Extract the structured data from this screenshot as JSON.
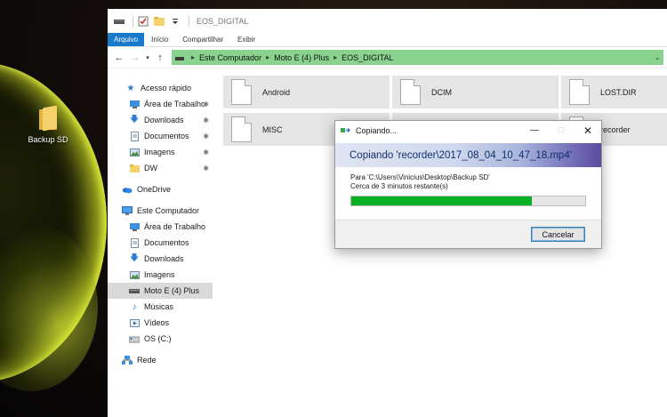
{
  "desktop": {
    "icon_label": "Backup SD"
  },
  "explorer": {
    "title": "EOS_DIGITAL",
    "ribbon_tabs": [
      "Arquivo",
      "Início",
      "Compartilhar",
      "Exibir"
    ],
    "breadcrumb": [
      "Este Computador",
      "Moto E (4) Plus",
      "EOS_DIGITAL"
    ],
    "nav": {
      "quick_access": "Acesso rápido",
      "quick_items": [
        "Área de Trabalho",
        "Downloads",
        "Documentos",
        "Imagens",
        "DW"
      ],
      "onedrive": "OneDrive",
      "this_pc": "Este Computador",
      "pc_items": [
        "Área de Trabalho",
        "Documentos",
        "Downloads",
        "Imagens",
        "Moto E (4) Plus",
        "Músicas",
        "Vídeos",
        "OS (C:)"
      ],
      "network": "Rede"
    },
    "folders": [
      "Android",
      "DCIM",
      "LOST.DIR",
      "MISC",
      "recorder"
    ]
  },
  "dialog": {
    "title": "Copiando...",
    "header": "Copiando 'recorder\\2017_08_04_10_47_18.mp4'",
    "destination": "Para 'C:\\Users\\Vinicius\\Desktop\\Backup SD'",
    "time_remaining": "Cerca de 3 minutos restante(s)",
    "progress": 0.77,
    "cancel_label": "Cancelar"
  },
  "colors": {
    "ribbon_file_tab": "#1979ca",
    "address_bar": "#8ad38e",
    "progress_fill": "#06b025",
    "tile_bg": "#e5e5e5"
  },
  "icons": {
    "folder": "folder-icon",
    "drive": "drive-icon",
    "star": "star-icon",
    "cloud": "cloud-icon",
    "pc": "computer-icon",
    "network": "network-icon",
    "pin": "pin-icon"
  }
}
